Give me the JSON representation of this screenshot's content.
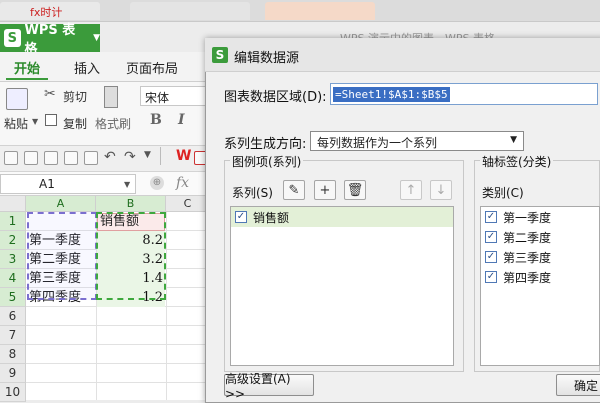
{
  "browser": {
    "tab_red_text": "fx时计",
    "background_window_title": "WPS 演示中的图表 - WPS 表格"
  },
  "app": {
    "title": "WPS 表格",
    "logo_letter": "S",
    "ribbon_tabs": [
      "开始",
      "插入",
      "页面布局"
    ],
    "paste_label": "粘贴",
    "cut_label": "剪切",
    "copy_label": "复制",
    "format_painter_label": "格式刷",
    "font_name": "宋体",
    "format_buttons": [
      "B",
      "I"
    ]
  },
  "namebox": {
    "value": "A1",
    "fx": "fx"
  },
  "sheet": {
    "columns": [
      "A",
      "B",
      "C"
    ],
    "rows": [
      "1",
      "2",
      "3",
      "4",
      "5",
      "6",
      "7",
      "8",
      "9",
      "10"
    ],
    "header_b1": "销售额",
    "data": [
      {
        "a": "第一季度",
        "b": "8.2"
      },
      {
        "a": "第二季度",
        "b": "3.2"
      },
      {
        "a": "第三季度",
        "b": "1.4"
      },
      {
        "a": "第四季度",
        "b": "1.2"
      }
    ]
  },
  "dialog": {
    "title": "编辑数据源",
    "range_label": "图表数据区域(D):",
    "range_value": "=Sheet1!$A$1:$B$5",
    "series_dir_label": "系列生成方向:",
    "series_dir_value": "每列数据作为一个系列",
    "legend_group_title": "图例项(系列)",
    "series_label": "系列(S)",
    "series_items": [
      {
        "label": "销售额",
        "checked": true
      }
    ],
    "axis_group_title": "轴标签(分类)",
    "category_label": "类别(C)",
    "category_items": [
      {
        "label": "第一季度",
        "checked": true
      },
      {
        "label": "第二季度",
        "checked": true
      },
      {
        "label": "第三季度",
        "checked": true
      },
      {
        "label": "第四季度",
        "checked": true
      }
    ],
    "advanced_label": "高级设置(A) >>",
    "ok_label": "确定"
  },
  "colors": {
    "brand_green": "#3b9b3b",
    "selection_blue": "#3a6ec3"
  }
}
